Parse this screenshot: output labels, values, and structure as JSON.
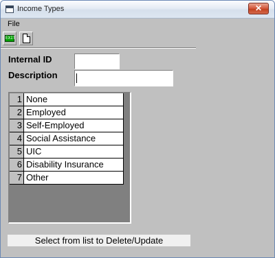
{
  "window": {
    "title": "Income Types",
    "close_glyph": "✕"
  },
  "menu": {
    "file": "File"
  },
  "toolbar": {
    "exit_label": "EXIT"
  },
  "form": {
    "internal_id_label": "Internal ID",
    "description_label": "Description",
    "internal_id_value": "",
    "description_value": ""
  },
  "grid": {
    "rows": [
      {
        "num": "1",
        "name": "None"
      },
      {
        "num": "2",
        "name": "Employed"
      },
      {
        "num": "3",
        "name": "Self-Employed"
      },
      {
        "num": "4",
        "name": "Social Assistance"
      },
      {
        "num": "5",
        "name": "UIC"
      },
      {
        "num": "6",
        "name": "Disability Insurance"
      },
      {
        "num": "7",
        "name": "Other"
      }
    ]
  },
  "status": {
    "text": "Select from list to Delete/Update"
  },
  "colors": {
    "close_button": "#c2401f",
    "exit_icon": "#00a000",
    "grid_background": "#808080"
  }
}
